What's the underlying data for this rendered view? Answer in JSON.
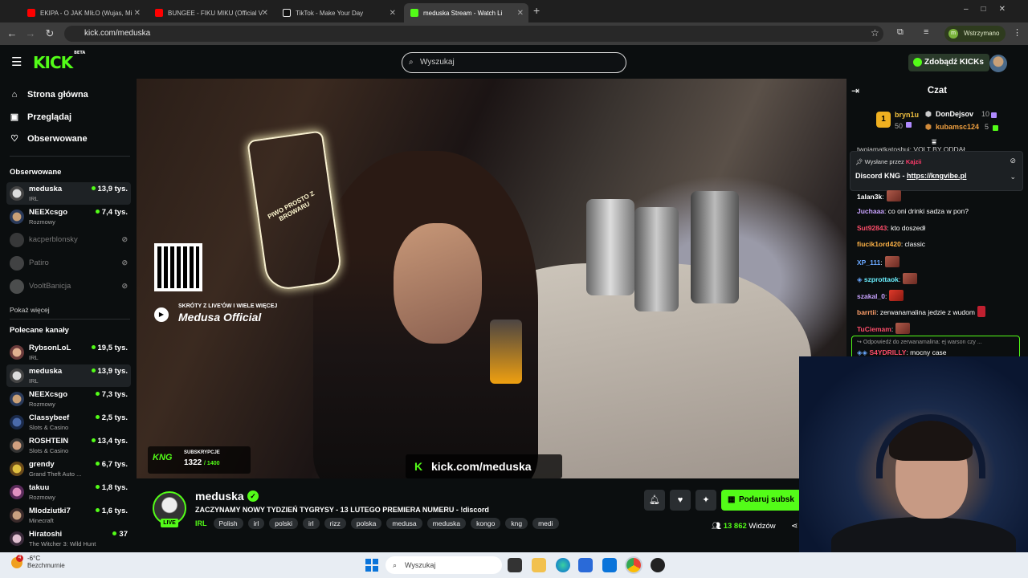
{
  "browser": {
    "tabs": [
      {
        "title": "EKIPA - O JAK MIŁO (Wujas, Mi",
        "icon": "youtube-icon"
      },
      {
        "title": "BUNGEE - FIKU MIKU (Official V",
        "icon": "youtube-icon"
      },
      {
        "title": "TikTok - Make Your Day",
        "icon": "tiktok-icon"
      },
      {
        "title": "meduska Stream - Watch Li",
        "icon": "kick-icon"
      }
    ],
    "url": "kick.com/meduska",
    "profile_label": "Wstrzymano",
    "profile_initial": "m"
  },
  "header": {
    "logo": "KICK",
    "logo_badge": "BETA",
    "search_placeholder": "Wyszukaj",
    "kicks_button": "Zdobądź KICKs"
  },
  "sidebar": {
    "nav": [
      {
        "label": "Strona główna",
        "icon": "home-icon"
      },
      {
        "label": "Przeglądaj",
        "icon": "browse-icon"
      },
      {
        "label": "Obserwowane",
        "icon": "heart-icon"
      }
    ],
    "followed_heading": "Obserwowane",
    "followed": [
      {
        "name": "meduska",
        "category": "IRL",
        "viewers": "13,9 tys."
      },
      {
        "name": "NEEXcsgo",
        "category": "Rozmowy",
        "viewers": "7,4 tys."
      },
      {
        "name": "kacperblonsky",
        "offline": true
      },
      {
        "name": "Patiro",
        "offline": true
      },
      {
        "name": "VooltBanicja",
        "offline": true
      }
    ],
    "show_more": "Pokaż więcej",
    "recommended_heading": "Polecane kanały",
    "recommended": [
      {
        "name": "RybsonLoL",
        "category": "IRL",
        "viewers": "19,5 tys."
      },
      {
        "name": "meduska",
        "category": "IRL",
        "viewers": "13,9 tys."
      },
      {
        "name": "NEEXcsgo",
        "category": "Rozmowy",
        "viewers": "7,3 tys."
      },
      {
        "name": "Classybeef",
        "category": "Slots & Casino",
        "viewers": "2,5 tys."
      },
      {
        "name": "ROSHTEIN",
        "category": "Slots & Casino",
        "viewers": "13,4 tys."
      },
      {
        "name": "grendy",
        "category": "Grand Theft Auto ...",
        "viewers": "6,7 tys."
      },
      {
        "name": "takuu",
        "category": "Rozmowy",
        "viewers": "1,8 tys."
      },
      {
        "name": "Mlodziutki7",
        "category": "Minecraft",
        "viewers": "1,6 tys."
      },
      {
        "name": "Hiratoshi",
        "category": "The Witcher 3: Wild Hunt",
        "viewers": "37"
      }
    ]
  },
  "video": {
    "overlay_small": "SKRÓTY Z LIVE'ÓW I WIELE WIĘCEJ",
    "overlay_big": "Medusa Official",
    "sub_label": "SUBSKRYPCJE",
    "sub_count": "1322",
    "sub_goal": "/ 1400",
    "sub_logo": "KNG",
    "url_overlay": "kick.com/meduska",
    "neon_sign": "PIWO PROSTO Z BROWARU"
  },
  "stream": {
    "name": "meduska",
    "live": "LIVE",
    "title": "ZACZYNAMY NOWY TYDZIEŃ TYGRYSY - 13 LUTEGO PREMIERA NUMERU - !discord",
    "category": "IRL",
    "tags": [
      "Polish",
      "irl",
      "polski",
      "irl",
      "rizz",
      "polska",
      "medusa",
      "meduska",
      "kongo",
      "kng",
      "medi"
    ],
    "gift_button": "Podaruj subsk",
    "viewers": "13 862",
    "viewers_label": "Widzów"
  },
  "chat": {
    "title": "Czat",
    "leaderboard": {
      "first": {
        "rank": "1",
        "name": "bryn1u",
        "count": "50"
      },
      "second": {
        "name": "DonDejsov",
        "count": "10"
      },
      "third": {
        "name": "kubamsc124",
        "count": "5"
      }
    },
    "pinned": {
      "by_label": "Wysłane przez",
      "by_user": "Kajzii",
      "text": "Discord KNG - ",
      "link": "https://kngvibe.pl"
    },
    "top_cut": "twojamatkatoshui: VOLT BY ODDAŁ",
    "messages": [
      {
        "user": "1alan3k",
        "text": "",
        "color": "#ffffff",
        "emote": true
      },
      {
        "user": "Juchaaa",
        "text": "co oni drinki sadza w pon?",
        "color": "#c9a3ff"
      },
      {
        "user": "Sut92843",
        "text": "kto doszedł",
        "color": "#ff4d6a"
      },
      {
        "user": "fiucik1ord420",
        "text": "classic",
        "color": "#ffb347"
      },
      {
        "user": "XP_111",
        "text": "",
        "color": "#6aa8ff",
        "emote": true
      },
      {
        "user": "szprottaok",
        "text": "",
        "color": "#6af0ff",
        "emote": true
      },
      {
        "user": "szakal_0",
        "text": "",
        "color": "#c9a3ff",
        "emote": true
      },
      {
        "user": "barrtii",
        "text": "zerwanamalina jedzie z wudom",
        "color": "#ff9f6a"
      },
      {
        "user": "TuCiemam",
        "text": "",
        "color": "#ff4d6a",
        "emote": true
      }
    ],
    "reply": {
      "to": "Odpowiedź do zerwanamalina: ej warson czy ...",
      "user": "S4YDRILLY",
      "text": "mocny case"
    }
  },
  "taskbar": {
    "temperature": "-6°C",
    "weather": "Bezchmurnie",
    "notification_count": "4",
    "search_placeholder": "Wyszukaj"
  }
}
